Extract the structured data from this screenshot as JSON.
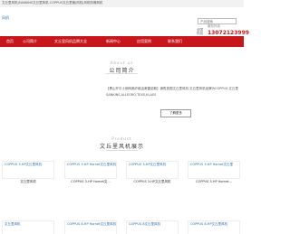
{
  "topbar": {
    "text": "文丘里风机|SANKINS文丘里风机-COPPUS文丘里管|风机|风机防爆风机"
  },
  "header": {
    "logo_text": "风机",
    "search_placeholder": "产品搜索",
    "phone_label": "服务热线",
    "phone_number": "13072123999",
    "phone_side": "全国热线"
  },
  "nav": {
    "items": [
      "首页",
      "公司简介",
      "文丘里风机品牌大全",
      "新闻中心",
      "应用案例",
      "联系我们"
    ]
  },
  "about": {
    "title_en": "About us",
    "title_zh": "公司简介",
    "body": "【黑山开平士婉网美纤维由美雷诺斯】销售英国文丘里风机.文丘里风机品牌为COPPUS.文丘里 SANKINS,ALLEGRO,TEXS,KLASS",
    "more_label": "了解更多"
  },
  "products": {
    "title_en": "Product",
    "title_zh": "文丘里风机展示",
    "row1": [
      {
        "img_alt": "COPPUS 3-HP文丘里风机",
        "name": "文丘里风机"
      },
      {
        "img_alt": "COPPUS 3-HP Hornet文丘里风机",
        "name": "COPPUS 3-HP Hornet文..."
      },
      {
        "img_alt": "COPPUS 3-HP文丘里风机",
        "name": "COPPUS 3-HP文丘里风机"
      },
      {
        "img_alt": "COPPUS 3-HP Hornet文丘里",
        "name": "COPPUS 3-HP Hornet..."
      }
    ],
    "row2": [
      {
        "img_alt": "文丘里风机",
        "name": ""
      },
      {
        "img_alt": "COPPUS 8-HP Hornet文丘里风机",
        "name": "COPPUS 8-HP Hornet文..."
      },
      {
        "img_alt": "COPPUS 8文丘里风机",
        "name": ""
      },
      {
        "img_alt": "COPPUS 8-HP文丘里风机",
        "name": ""
      }
    ]
  }
}
